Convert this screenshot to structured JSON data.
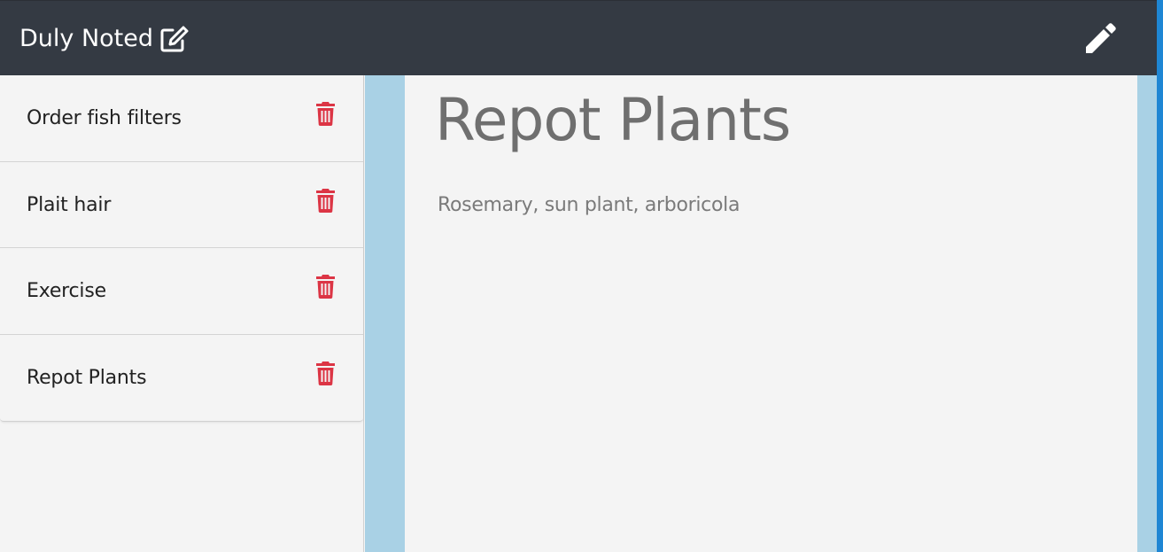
{
  "navbar": {
    "brand": "Duly Noted",
    "brand_icon": "edit-square-icon",
    "new_note_icon": "pencil-icon"
  },
  "sidebar": {
    "notes": [
      {
        "title": "Order fish filters",
        "delete_icon": "trash-icon"
      },
      {
        "title": "Plait hair",
        "delete_icon": "trash-icon"
      },
      {
        "title": "Exercise",
        "delete_icon": "trash-icon"
      },
      {
        "title": "Repot Plants",
        "delete_icon": "trash-icon"
      }
    ]
  },
  "note": {
    "title": "Repot Plants",
    "body": "Rosemary, sun plant, arboricola"
  },
  "colors": {
    "navbar": "#343a43",
    "accent_stripe": "#a9d1e5",
    "delete": "#dc3545",
    "right_edge": "#1e86d4"
  }
}
